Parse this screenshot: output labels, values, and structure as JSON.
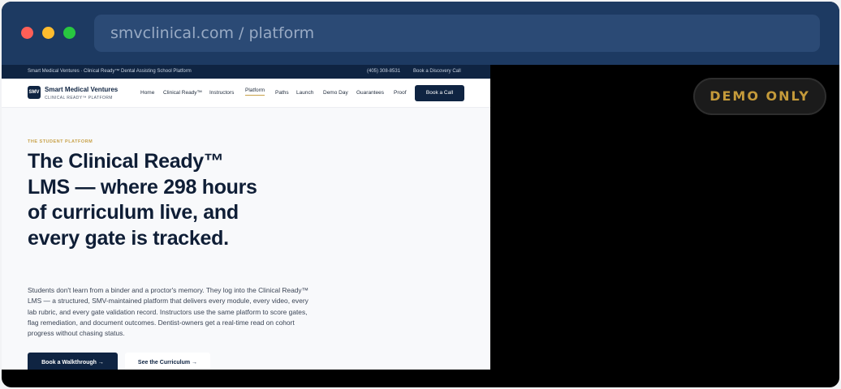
{
  "browser": {
    "url": "smvclinical.com / platform"
  },
  "topbar": {
    "left_text": "Smart Medical Ventures · Clinical Ready™ Dental Assisting School Platform",
    "phone": "(405) 308-8531",
    "cta": "Book a Discovery Call"
  },
  "nav": {
    "logo": "SMV",
    "brand": "Smart Medical Ventures",
    "brand_sub": "CLINICAL READY™ PLATFORM",
    "items": [
      "Home",
      "Clinical Ready™",
      "Instructors",
      "Platform",
      "Paths",
      "Launch",
      "Demo Day",
      "Guarantees",
      "Proof"
    ],
    "active": "Platform",
    "book_call": "Book a Call"
  },
  "hero": {
    "eyebrow": "THE STUDENT PLATFORM",
    "headline": "The Clinical Ready™ LMS — where 298 hours of curriculum live, and every gate is tracked.",
    "body": "Students don't learn from a binder and a proctor's memory. They log into the Clinical Ready™ LMS — a structured, SMV-maintained platform that delivers every module, every video, every lab rubric, and every gate validation record. Instructors use the same platform to score gates, flag remediation, and document outcomes. Dentist-owners get a real-time read on cohort progress without chasing status.",
    "primary_button": "Book a Walkthrough →",
    "secondary_button": "See the Curriculum →"
  },
  "badge": {
    "label": "DEMO ONLY"
  },
  "colors": {
    "chrome": "#1d3a62",
    "navy": "#0f2442",
    "gold": "#c8a24a"
  }
}
